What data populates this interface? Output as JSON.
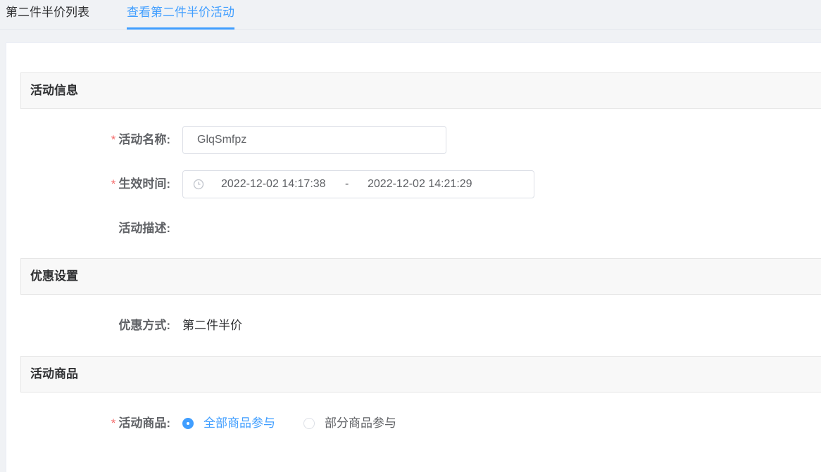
{
  "tabs": [
    {
      "label": "第二件半价列表"
    },
    {
      "label": "查看第二件半价活动"
    }
  ],
  "sections": {
    "info": {
      "title": "活动信息"
    },
    "discount": {
      "title": "优惠设置"
    },
    "goods": {
      "title": "活动商品"
    }
  },
  "form": {
    "name": {
      "required_mark": "*",
      "label": "活动名称:",
      "value": "GlqSmfpz"
    },
    "time": {
      "required_mark": "*",
      "label": "生效时间:",
      "start": "2022-12-02 14:17:38",
      "separator": "-",
      "end": "2022-12-02 14:21:29",
      "icon": "clock-icon"
    },
    "desc": {
      "label": "活动描述:"
    },
    "discount_method": {
      "label": "优惠方式:",
      "value": "第二件半价"
    },
    "goods": {
      "required_mark": "*",
      "label": "活动商品:",
      "options": [
        {
          "label": "全部商品参与",
          "checked": true
        },
        {
          "label": "部分商品参与",
          "checked": false
        }
      ]
    }
  },
  "colors": {
    "accent": "#409eff",
    "required": "#f56c6c"
  }
}
